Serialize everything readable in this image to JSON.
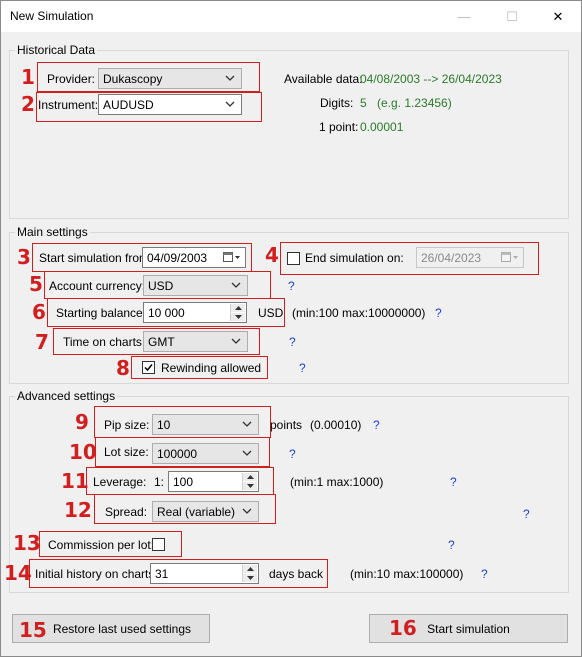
{
  "window": {
    "title": "New Simulation",
    "controls": {
      "minimize": "—",
      "maximize": "☐",
      "close": "✕"
    }
  },
  "historical": {
    "legend": "Historical Data",
    "provider_label": "Provider:",
    "provider_value": "Dukascopy",
    "instrument_label": "Instrument:",
    "instrument_value": "AUDUSD",
    "available_label": "Available data:",
    "available_value": "04/08/2003 --> 26/04/2023",
    "digits_label": "Digits:",
    "digits_value": "5",
    "digits_example": "(e.g. 1.23456)",
    "point_label": "1 point:",
    "point_value": "0.00001"
  },
  "main": {
    "legend": "Main settings",
    "start_label": "Start simulation from:",
    "start_value": "04/09/2003",
    "end_label": "End simulation on:",
    "end_value": "26/04/2023",
    "end_checked": false,
    "currency_label": "Account currency:",
    "currency_value": "USD",
    "balance_label": "Starting balance:",
    "balance_value": "10 000",
    "balance_unit": "USD",
    "balance_range": "(min:100  max:10000000)",
    "time_label": "Time on charts:",
    "time_value": "GMT",
    "rewind_label": "Rewinding allowed",
    "rewind_checked": true
  },
  "advanced": {
    "legend": "Advanced settings",
    "pip_label": "Pip size:",
    "pip_value": "10",
    "pip_unit": "points",
    "pip_example": "(0.00010)",
    "lot_label": "Lot size:",
    "lot_value": "100000",
    "leverage_label": "Leverage:",
    "leverage_prefix": "1:",
    "leverage_value": "100",
    "leverage_range": "(min:1  max:1000)",
    "spread_label": "Spread:",
    "spread_value": "Real (variable)",
    "commission_label": "Commission per lot:",
    "commission_checked": false,
    "history_label": "Initial history on charts:",
    "history_value": "31",
    "history_unit": "days back",
    "history_range": "(min:10  max:100000)"
  },
  "help": "?",
  "buttons": {
    "restore": "Restore last used settings",
    "start": "Start simulation"
  },
  "markers": [
    "1",
    "2",
    "3",
    "4",
    "5",
    "6",
    "7",
    "8",
    "9",
    "10",
    "11",
    "12",
    "13",
    "14",
    "15",
    "16"
  ],
  "colors": {
    "marker": "#d11f1f",
    "info_value": "#2a7a2a",
    "help": "#1f3fd0"
  }
}
